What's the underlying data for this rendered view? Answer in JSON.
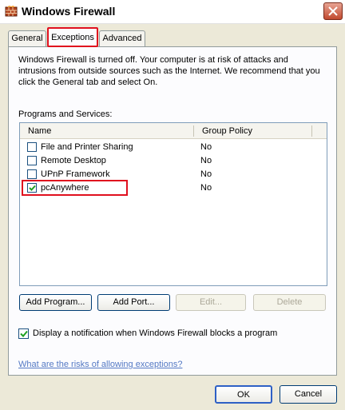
{
  "window": {
    "title": "Windows Firewall",
    "icon": "firewall-brick-icon",
    "close_icon": "close-icon"
  },
  "tabs": [
    {
      "label": "General",
      "selected": false
    },
    {
      "label": "Exceptions",
      "selected": true
    },
    {
      "label": "Advanced",
      "selected": false
    }
  ],
  "warning_text": "Windows Firewall is turned off. Your computer is at risk of attacks and intrusions from outside sources such as the Internet. We recommend that you click the General tab and select On.",
  "programs": {
    "label": "Programs and Services:",
    "columns": [
      "Name",
      "Group Policy"
    ],
    "rows": [
      {
        "name": "File and Printer Sharing",
        "policy": "No",
        "checked": false
      },
      {
        "name": "Remote Desktop",
        "policy": "No",
        "checked": false
      },
      {
        "name": "UPnP Framework",
        "policy": "No",
        "checked": false
      },
      {
        "name": "pcAnywhere",
        "policy": "No",
        "checked": true
      }
    ]
  },
  "buttons": {
    "add_program": "Add Program...",
    "add_port": "Add Port...",
    "edit": "Edit...",
    "delete": "Delete",
    "ok": "OK",
    "cancel": "Cancel"
  },
  "notification": {
    "label": "Display a notification when Windows Firewall blocks a program",
    "checked": true
  },
  "help_link": "What are the risks of allowing exceptions?",
  "colors": {
    "highlight_red": "#e0101e",
    "dialog_bg": "#ece9d8",
    "link": "#5479c4"
  }
}
